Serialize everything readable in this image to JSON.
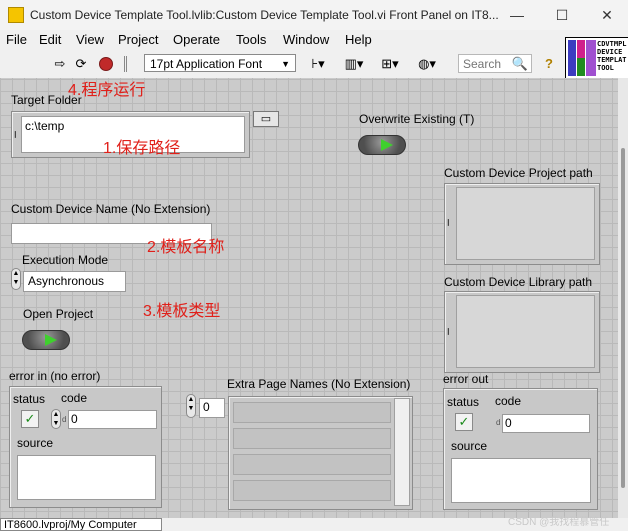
{
  "window": {
    "title": "Custom Device Template Tool.lvlib:Custom Device Template Tool.vi Front Panel on IT8...",
    "minimize": "—",
    "maximize": "☐",
    "close": "✕"
  },
  "menu": [
    "File",
    "Edit",
    "View",
    "Project",
    "Operate",
    "Tools",
    "Window",
    "Help"
  ],
  "toolbar": {
    "font": "17pt Application Font",
    "search_placeholder": "Search",
    "help": "?"
  },
  "vi_icon": {
    "lines": [
      "CDVTMPL",
      "DEVICE",
      "TEMPLAT",
      "TOOL"
    ]
  },
  "annotations": {
    "run": "4.程序运行",
    "path": "1.保存路径",
    "name": "2.模板名称",
    "type": "3.模板类型"
  },
  "controls": {
    "target_folder": {
      "label": "Target Folder",
      "value": "c:\\temp"
    },
    "overwrite": {
      "label": "Overwrite Existing (T)"
    },
    "cd_project_path": {
      "label": "Custom Device Project path"
    },
    "cd_name": {
      "label": "Custom Device Name (No Extension)",
      "value": ""
    },
    "cd_library_path": {
      "label": "Custom Device Library path"
    },
    "execution_mode": {
      "label": "Execution Mode",
      "value": "Asynchronous"
    },
    "open_project": {
      "label": "Open Project"
    },
    "error_in": {
      "label": "error in (no error)",
      "status": "status",
      "code": "code",
      "code_value": "0",
      "source": "source"
    },
    "extra_pages": {
      "label": "Extra Page Names (No Extension)",
      "index": "0"
    },
    "error_out": {
      "label": "error out",
      "status": "status",
      "code": "code",
      "code_value": "0",
      "source": "source"
    }
  },
  "statusbar": {
    "context": "IT8600.lvproj/My Computer"
  },
  "watermark": "CSDN @我找程慕管任"
}
